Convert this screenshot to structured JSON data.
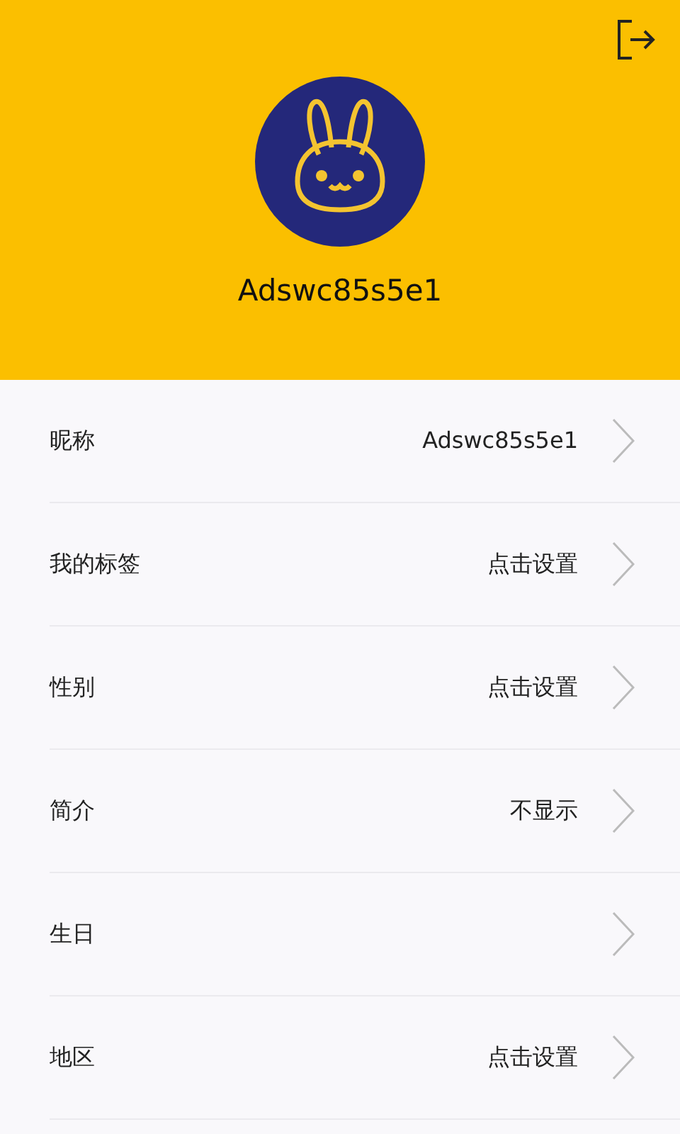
{
  "header": {
    "username": "Adswc85s5e1"
  },
  "settings": [
    {
      "label": "昵称",
      "value": "Adswc85s5e1"
    },
    {
      "label": "我的标签",
      "value": "点击设置"
    },
    {
      "label": "性别",
      "value": "点击设置"
    },
    {
      "label": "简介",
      "value": "不显示"
    },
    {
      "label": "生日"
    },
    {
      "label": "地区",
      "value": "点击设置"
    }
  ]
}
